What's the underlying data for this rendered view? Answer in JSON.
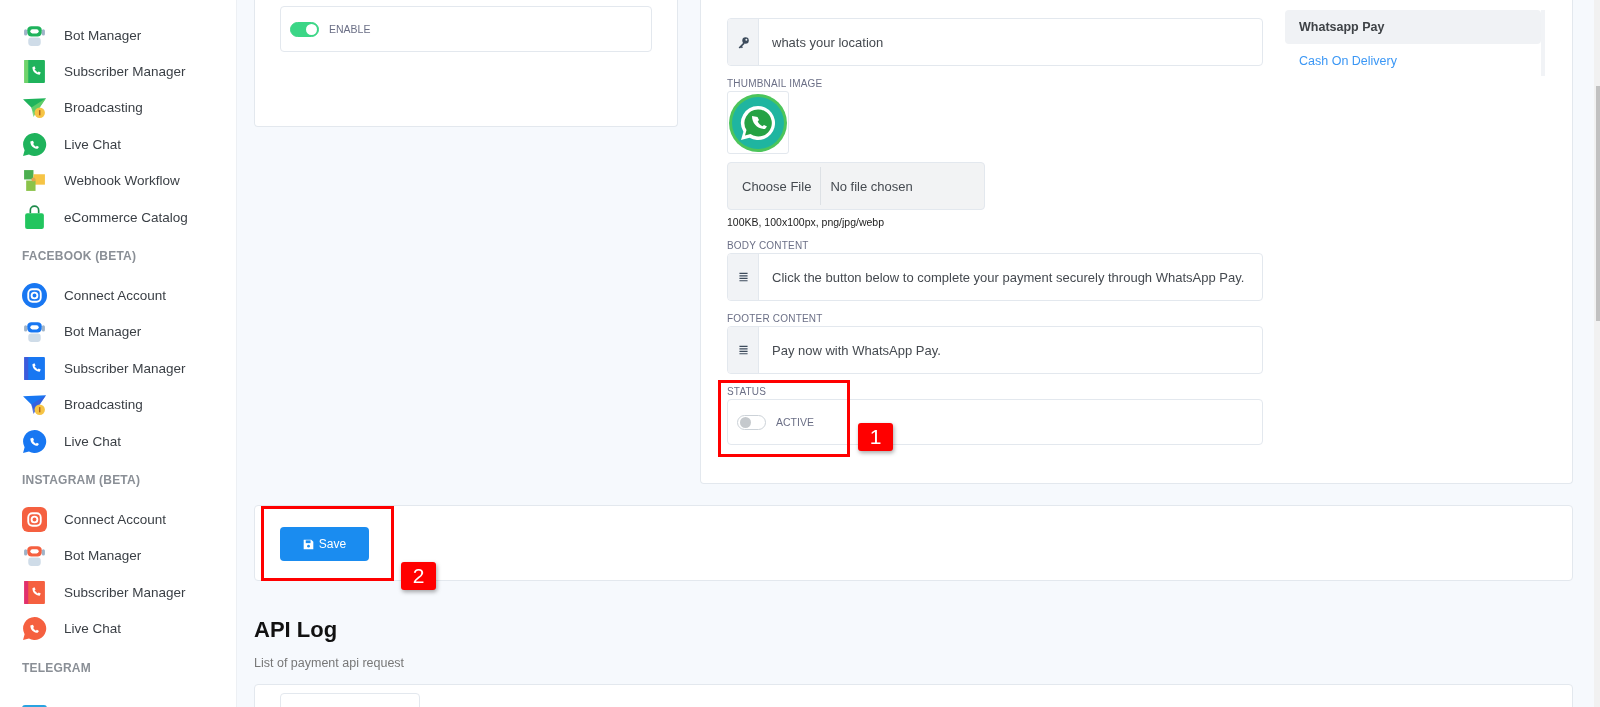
{
  "sidebar": {
    "sections": [
      {
        "items": [
          {
            "label": "Bot Manager",
            "kind": "bot"
          },
          {
            "label": "Subscriber Manager",
            "kind": "subscriber"
          },
          {
            "label": "Broadcasting",
            "kind": "broadcast"
          },
          {
            "label": "Live Chat",
            "kind": "chat"
          },
          {
            "label": "Webhook Workflow",
            "kind": "webhook"
          },
          {
            "label": "eCommerce Catalog",
            "kind": "catalog"
          }
        ]
      },
      {
        "header": "FACEBOOK (BETA)",
        "items": [
          {
            "label": "Connect Account",
            "kind": "connect"
          },
          {
            "label": "Bot Manager",
            "kind": "bot"
          },
          {
            "label": "Subscriber Manager",
            "kind": "subscriber"
          },
          {
            "label": "Broadcasting",
            "kind": "broadcast"
          },
          {
            "label": "Live Chat",
            "kind": "chat"
          }
        ]
      },
      {
        "header": "INSTAGRAM (BETA)",
        "items": [
          {
            "label": "Connect Account",
            "kind": "connect"
          },
          {
            "label": "Bot Manager",
            "kind": "bot"
          },
          {
            "label": "Subscriber Manager",
            "kind": "subscriber"
          },
          {
            "label": "Live Chat",
            "kind": "chat"
          }
        ]
      },
      {
        "header": "TELEGRAM"
      }
    ]
  },
  "thousand_comma": {
    "toggle_label": "ENABLE",
    "on": true
  },
  "form": {
    "shipping_message": {
      "value": "whats your location"
    },
    "thumbnail": {
      "label": "THUMBNAIL IMAGE",
      "choose_button": "Choose File",
      "file_status": "No file chosen",
      "hint": "100KB, 100x100px, png/jpg/webp"
    },
    "body_content": {
      "label": "BODY CONTENT",
      "value": "Click the button below to complete your payment securely through WhatsApp Pay."
    },
    "footer_content": {
      "label": "FOOTER CONTENT",
      "value": "Pay now with WhatsApp Pay."
    },
    "status": {
      "label": "STATUS",
      "toggle_label": "ACTIVE",
      "on": false,
      "annotation": "1"
    }
  },
  "payment_methods": [
    {
      "label": "Whatsapp Pay",
      "selected": true
    },
    {
      "label": "Cash On Delivery",
      "selected": false
    }
  ],
  "save_button": "Save",
  "save_annotation": "2",
  "api_log": {
    "title": "API Log",
    "subtitle": "List of payment api request"
  }
}
